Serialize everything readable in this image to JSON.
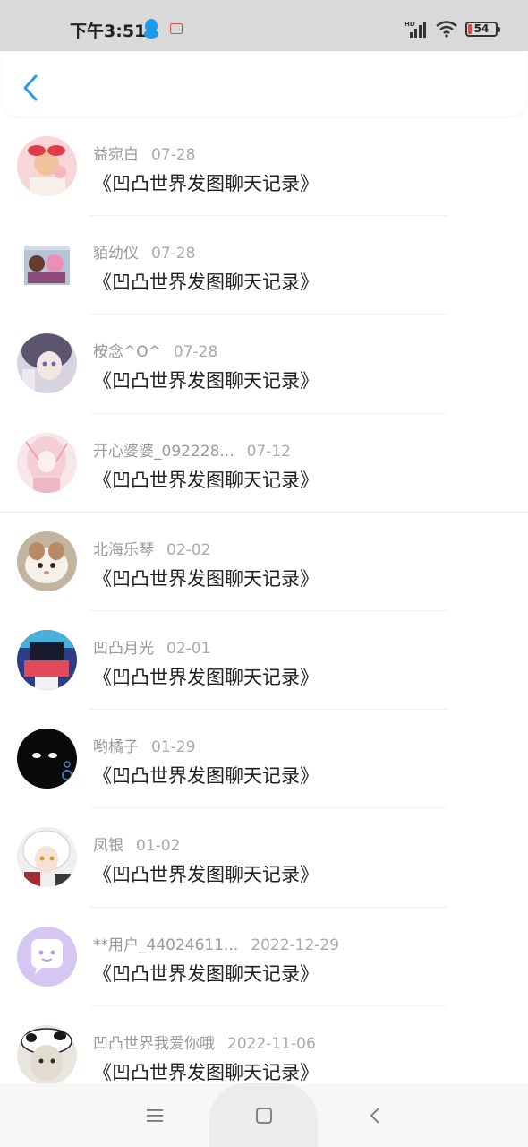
{
  "status_bar": {
    "time": "下午3:51",
    "battery": "54",
    "icons": [
      "qq-icon",
      "app-notification-icon",
      "hd-signal-icon",
      "wifi-icon",
      "battery-icon"
    ]
  },
  "header": {
    "back_icon": "chevron-left-icon"
  },
  "colors": {
    "accent": "#2b9be8",
    "title_text": "#222222",
    "meta_text": "#999999",
    "status_bar_bg": "#d9d9d9"
  },
  "items": [
    {
      "name": "益宛白",
      "date": "07-28",
      "title": "《凹凸世界发图聊天记录》"
    },
    {
      "name": "貊幼仪",
      "date": "07-28",
      "title": "《凹凸世界发图聊天记录》"
    },
    {
      "name": "桉念^O^",
      "date": "07-28",
      "title": "《凹凸世界发图聊天记录》"
    },
    {
      "name": "开心婆婆_092228...",
      "date": "07-12",
      "title": "《凹凸世界发图聊天记录》"
    },
    {
      "name": "北海乐琴",
      "date": "02-02",
      "title": "《凹凸世界发图聊天记录》"
    },
    {
      "name": "凹凸月光",
      "date": "02-01",
      "title": "《凹凸世界发图聊天记录》"
    },
    {
      "name": "哟橘子",
      "date": "01-29",
      "title": "《凹凸世界发图聊天记录》"
    },
    {
      "name": "凤银",
      "date": "01-02",
      "title": "《凹凸世界发图聊天记录》"
    },
    {
      "name": "**用户_44024611...",
      "date": "2022-12-29",
      "title": "《凹凸世界发图聊天记录》"
    },
    {
      "name": "凹凸世界我爱你哦",
      "date": "2022-11-06",
      "title": "《凹凸世界发图聊天记录》"
    }
  ],
  "nav": {
    "icons": [
      "menu-icon",
      "home-square-icon",
      "back-triangle-icon"
    ]
  }
}
